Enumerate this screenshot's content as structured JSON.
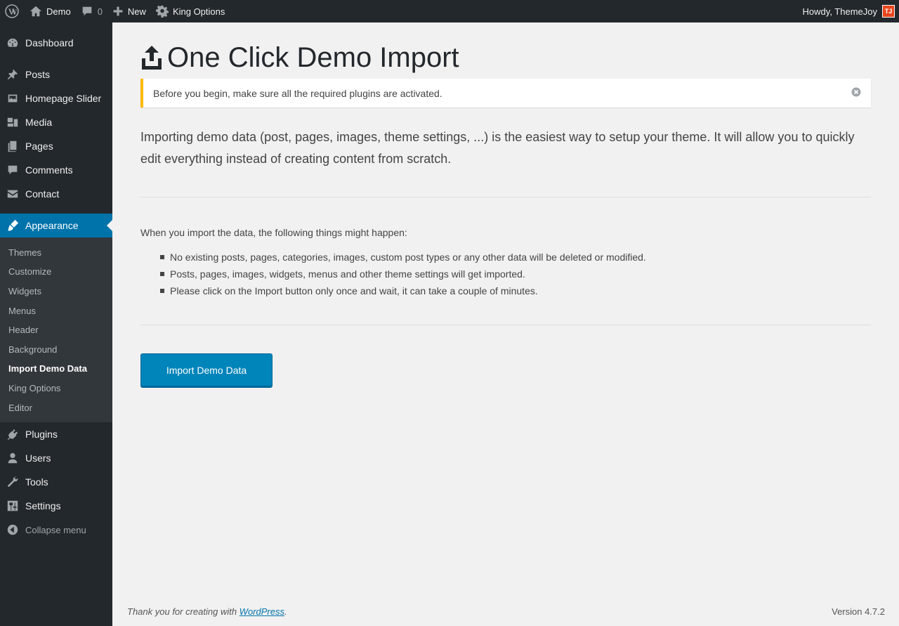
{
  "adminbar": {
    "site_name": "Demo",
    "comments_count": "0",
    "new_label": "New",
    "king_options_label": "King Options",
    "howdy": "Howdy, ThemeJoy",
    "avatar_letter": "TJ"
  },
  "sidebar": {
    "items": [
      {
        "label": "Dashboard",
        "icon": "dashboard-icon"
      },
      {
        "label": "Posts",
        "icon": "pushpin-icon"
      },
      {
        "label": "Homepage Slider",
        "icon": "slider-icon"
      },
      {
        "label": "Media",
        "icon": "media-icon"
      },
      {
        "label": "Pages",
        "icon": "pages-icon"
      },
      {
        "label": "Comments",
        "icon": "comment-icon"
      },
      {
        "label": "Contact",
        "icon": "envelope-icon"
      },
      {
        "label": "Appearance",
        "icon": "paintbrush-icon"
      },
      {
        "label": "Plugins",
        "icon": "plugin-icon"
      },
      {
        "label": "Users",
        "icon": "user-icon"
      },
      {
        "label": "Tools",
        "icon": "wrench-icon"
      },
      {
        "label": "Settings",
        "icon": "settings-icon"
      }
    ],
    "submenu": [
      "Themes",
      "Customize",
      "Widgets",
      "Menus",
      "Header",
      "Background",
      "Import Demo Data",
      "King Options",
      "Editor"
    ],
    "collapse_label": "Collapse menu"
  },
  "main": {
    "title": "One Click Demo Import",
    "notice": "Before you begin, make sure all the required plugins are activated.",
    "intro": "Importing demo data (post, pages, images, theme settings, ...) is the easiest way to setup your theme. It will allow you to quickly edit everything instead of creating content from scratch.",
    "happen_heading": "When you import the data, the following things might happen:",
    "bullets": [
      "No existing posts, pages, categories, images, custom post types or any other data will be deleted or modified.",
      "Posts, pages, images, widgets, menus and other theme settings will get imported.",
      "Please click on the Import button only once and wait, it can take a couple of minutes."
    ],
    "import_button": "Import Demo Data"
  },
  "footer": {
    "thanks_prefix": "Thank you for creating with ",
    "wordpress_link": "WordPress",
    "thanks_suffix": ".",
    "version": "Version 4.7.2"
  },
  "colors": {
    "adminbar_bg": "#23282d",
    "accent": "#0073aa",
    "button": "#0085ba",
    "notice_border": "#ffb900"
  }
}
